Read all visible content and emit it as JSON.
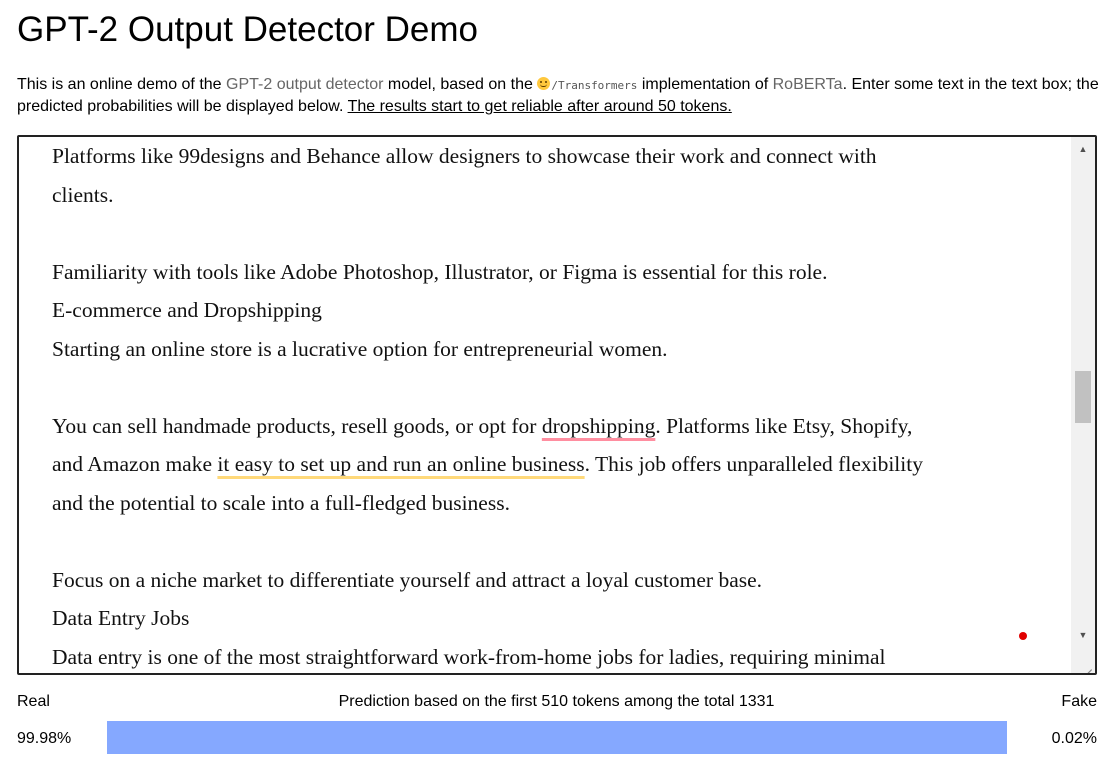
{
  "header": {
    "title": "GPT-2 Output Detector Demo"
  },
  "intro": {
    "part1": "This is an online demo of the ",
    "model_link": "GPT-2 output detector",
    "part2": " model, based on the ",
    "transformers_icon": "hugging-face-icon",
    "transformers_code": "/Transformers",
    "part3": " implementation of ",
    "roberta_link": "RoBERTa",
    "part4": ". Enter some text in the text box; the predicted probabilities will be displayed below. ",
    "note": "The results start to get reliable after around 50 tokens."
  },
  "editor": {
    "lines": [
      "Platforms like 99designs and Behance allow designers to showcase their work and connect with",
      "clients.",
      "",
      "Familiarity with tools like Adobe Photoshop, Illustrator, or Figma is essential for this role.",
      "E-commerce and Dropshipping",
      "Starting an online store is a lucrative option for entrepreneurial women.",
      "",
      "You can sell handmade products, resell goods, or opt for dropshipping. Platforms like Etsy, Shopify,",
      "and Amazon make it easy to set up and run an online business. This job offers unparalleled flexibility",
      "and the potential to scale into a full-fledged business.",
      "",
      "Focus on a niche market to differentiate yourself and attract a loyal customer base.",
      "Data Entry Jobs",
      "Data entry is one of the most straightforward work-from-home jobs for ladies, requiring minimal"
    ],
    "highlight_line_a": {
      "before": "You can sell handmade products, resell goods, or opt for ",
      "marked": "dropshipping",
      "after": ". Platforms like Etsy, Shopify,"
    },
    "highlight_line_b": {
      "before": "and Amazon make ",
      "marked": "it easy to set up and run an online business",
      "after": ". This job offers unparalleled flexibility"
    },
    "scroll_up_icon": "chevron-up-icon",
    "scroll_down_icon": "chevron-down-icon",
    "colors": {
      "spelling_underline": "#ff8ea0",
      "grammar_underline": "#ffd97a",
      "status_dot": "#e00000"
    }
  },
  "result": {
    "real_label": "Real",
    "fake_label": "Fake",
    "prediction_note": "Prediction based on the first 510 tokens among the total 1331",
    "real_percent": "99.98%",
    "fake_percent": "0.02%",
    "real_fraction": 0.9998,
    "bar_color": "#85a8ff"
  }
}
